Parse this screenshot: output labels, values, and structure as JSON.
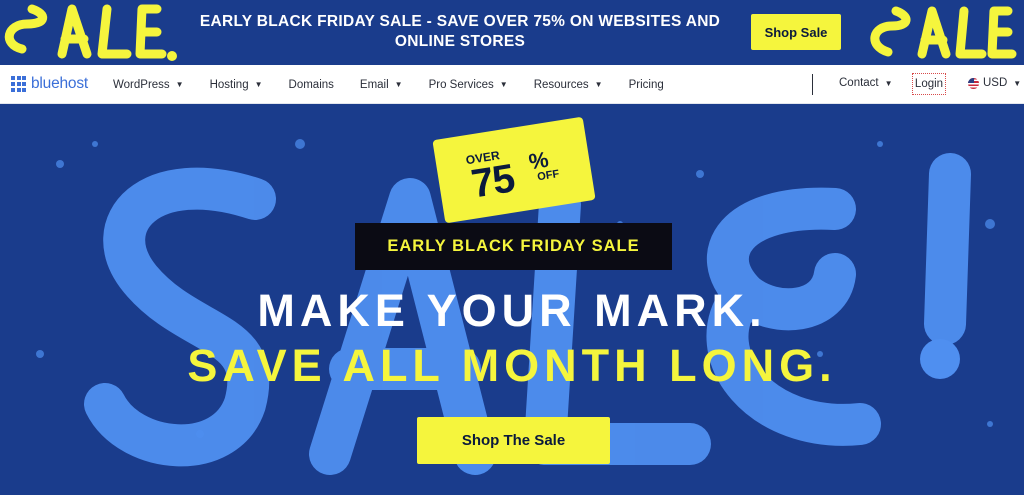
{
  "promo": {
    "line_prefix": "EARLY BLACK FRIDAY SALE - ",
    "line_highlight": "SAVE OVER 75%",
    "line_suffix": " ON WEBSITES AND ONLINE STORES",
    "button_label": "Shop Sale"
  },
  "nav": {
    "logo_text": "bluehost",
    "items": [
      {
        "label": "WordPress",
        "dropdown": true
      },
      {
        "label": "Hosting",
        "dropdown": true
      },
      {
        "label": "Domains",
        "dropdown": false
      },
      {
        "label": "Email",
        "dropdown": true
      },
      {
        "label": "Pro Services",
        "dropdown": true
      },
      {
        "label": "Resources",
        "dropdown": true
      },
      {
        "label": "Pricing",
        "dropdown": false
      }
    ],
    "contact_label": "Contact",
    "login_label": "Login",
    "currency_label": "USD"
  },
  "hero": {
    "sticker_over": "OVER",
    "sticker_number": "75",
    "sticker_symbol": "%",
    "sticker_off": "OFF",
    "pill_text": "EARLY BLACK FRIDAY SALE",
    "headline_1": "MAKE YOUR MARK.",
    "headline_2": "SAVE ALL MONTH LONG.",
    "cta_label": "Shop The Sale"
  },
  "colors": {
    "background": "#1a3c8c",
    "accent_yellow": "#f5f53d",
    "graffiti_blue": "#4f8ff0",
    "logo_blue": "#3b6fd8"
  },
  "icons": [
    "grid-logo-icon",
    "caret-down-icon",
    "us-flag-icon"
  ]
}
